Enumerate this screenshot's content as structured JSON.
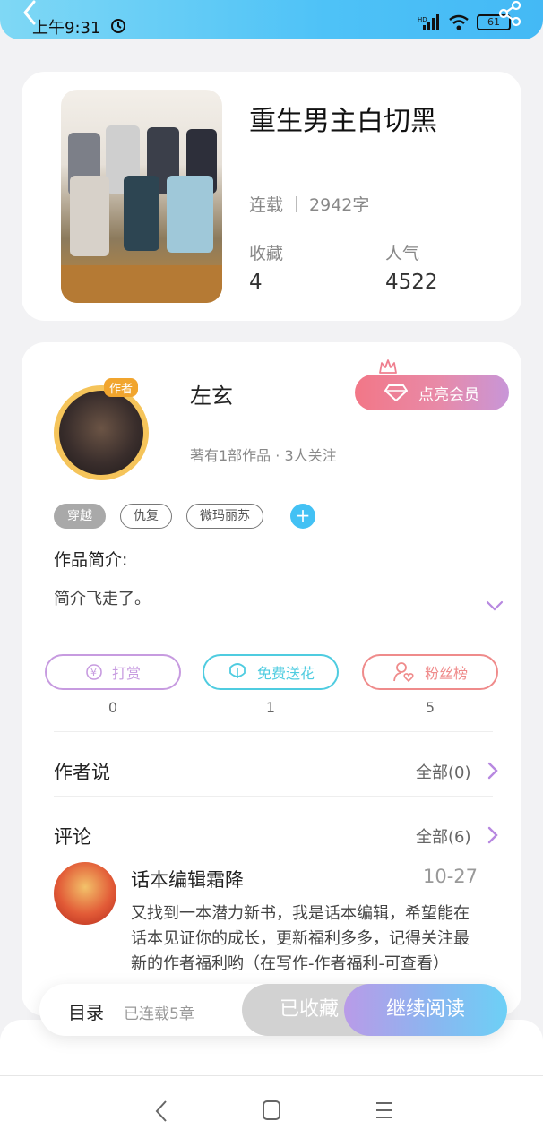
{
  "status": {
    "time": "上午9:31",
    "battery": "61"
  },
  "book": {
    "title": "重生男主白切黑",
    "status": "连载",
    "word_count": "2942字",
    "favorites_label": "收藏",
    "favorites_value": "4",
    "popularity_label": "人气",
    "popularity_value": "4522"
  },
  "author": {
    "badge": "作者",
    "name": "左玄",
    "info": "著有1部作品 · 3人关注",
    "vip_label": "点亮会员"
  },
  "tags": [
    "穿越",
    "仇复",
    "微玛丽苏"
  ],
  "intro": {
    "label": "作品简介:",
    "text": "简介飞走了。"
  },
  "actions": [
    {
      "label": "打赏",
      "count": "0",
      "color": "#c79be0"
    },
    {
      "label": "免费送花",
      "count": "1",
      "color": "#4fcce0"
    },
    {
      "label": "粉丝榜",
      "count": "5",
      "color": "#ef8b8b"
    }
  ],
  "author_says": {
    "title": "作者说",
    "all": "全部(0)"
  },
  "comments": {
    "title": "评论",
    "all": "全部(6)",
    "items": [
      {
        "name": "话本编辑霜降",
        "date": "10-27",
        "text": "又找到一本潜力新书，我是话本编辑，希望能在话本见证你的成长，更新福利多多，记得关注最新的作者福利哟（在写作-作者福利-可查看）"
      }
    ]
  },
  "bottom": {
    "toc": "目录",
    "toc_sub": "已连载5章",
    "collected": "已收藏",
    "read": "继续阅读"
  },
  "colors": {
    "accent_blue": "#43c1f4",
    "accent_purple": "#b788e0"
  }
}
